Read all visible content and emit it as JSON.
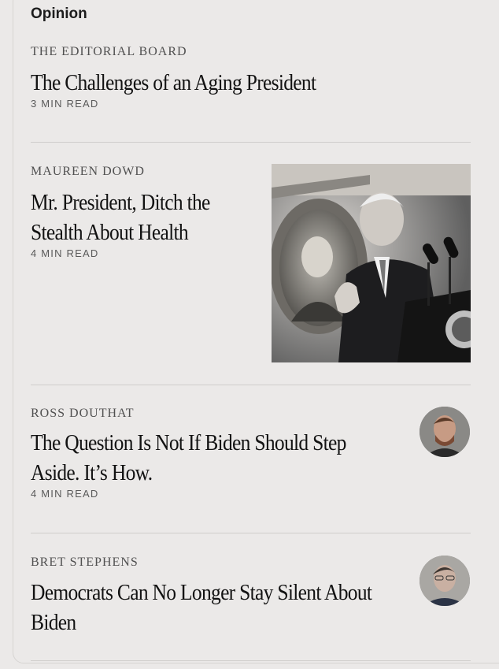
{
  "section": {
    "label": "Opinion"
  },
  "articles": [
    {
      "author": "THE EDITORIAL BOARD",
      "headline": "The Challenges of an Aging President",
      "read_time": "3 MIN READ"
    },
    {
      "author": "MAUREEN DOWD",
      "headline": "Mr. President, Ditch the Stealth About Health",
      "read_time": "4 MIN READ",
      "image": "president-at-podium-photo"
    },
    {
      "author": "ROSS DOUTHAT",
      "headline": "The Question Is Not If Biden Should Step Aside. It’s How.",
      "read_time": "4 MIN READ",
      "avatar": "author-avatar"
    },
    {
      "author": "BRET STEPHENS",
      "headline": "Democrats Can No Longer Stay Silent About Biden",
      "avatar": "author-avatar"
    }
  ],
  "colors": {
    "background": "#ebe9e8",
    "headline": "#121212",
    "author": "#505050",
    "divider": "#cfcdcb"
  }
}
